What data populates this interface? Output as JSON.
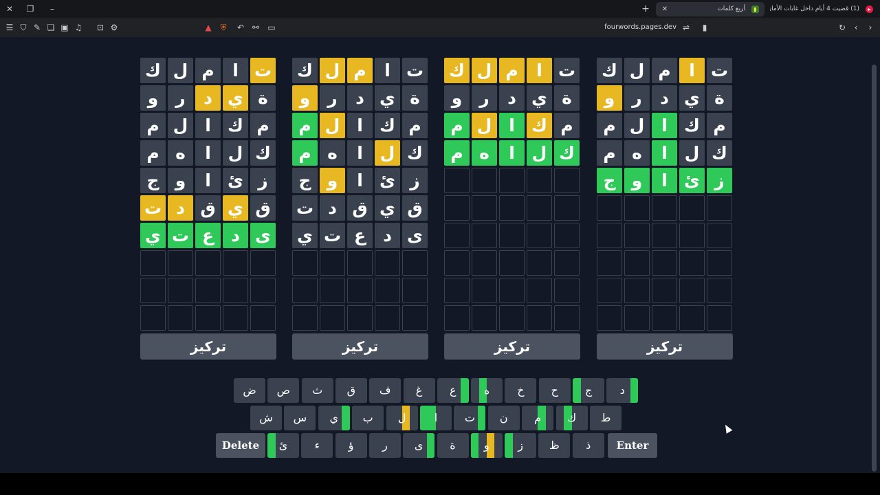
{
  "browser": {
    "active_tab": "أربع كلمات",
    "inactive_tab": "(1) قضيت 4 أيام داخل غابات الأمازون !",
    "url": "fourwords.pages.dev"
  },
  "colors": {
    "correct": "#2fc95a",
    "present": "#e8b823",
    "absent": "#3a4250",
    "background": "#121826"
  },
  "boards": [
    {
      "rows": [
        [
          "ت",
          "ا",
          "م",
          "ل",
          "ك"
        ],
        [
          "ة",
          "ي",
          "د",
          "ر",
          "و"
        ],
        [
          "م",
          "ك",
          "ا",
          "ل",
          "م"
        ],
        [
          "ك",
          "ل",
          "ا",
          "ه",
          "م"
        ],
        [
          "ز",
          "ئ",
          "ا",
          "و",
          "ج"
        ],
        [
          "ق",
          "ي",
          "ق",
          "د",
          "ت"
        ],
        [
          "ى",
          "د",
          "ع",
          "ت",
          "ي"
        ]
      ],
      "states": [
        [
          "y",
          "g0",
          "g0",
          "g0",
          "g0"
        ],
        [
          "g0",
          "y",
          "y",
          "g0",
          "g0"
        ],
        [
          "g0",
          "g0",
          "g0",
          "g0",
          "g0"
        ],
        [
          "g0",
          "g0",
          "g0",
          "g0",
          "g0"
        ],
        [
          "g0",
          "g0",
          "g0",
          "g0",
          "g0"
        ],
        [
          "g0",
          "y",
          "g0",
          "y",
          "y"
        ],
        [
          "G",
          "G",
          "G",
          "G",
          "G"
        ]
      ],
      "focus_label": "تركيز"
    },
    {
      "rows": [
        [
          "ت",
          "ا",
          "م",
          "ل",
          "ك"
        ],
        [
          "ة",
          "ي",
          "د",
          "ر",
          "و"
        ],
        [
          "م",
          "ك",
          "ا",
          "ل",
          "م"
        ],
        [
          "ك",
          "ل",
          "ا",
          "ه",
          "م"
        ],
        [
          "ز",
          "ئ",
          "ا",
          "و",
          "ج"
        ],
        [
          "ق",
          "ي",
          "ق",
          "د",
          "ت"
        ],
        [
          "ى",
          "د",
          "ع",
          "ت",
          "ي"
        ]
      ],
      "states": [
        [
          "g0",
          "g0",
          "y",
          "y",
          "g0"
        ],
        [
          "g0",
          "g0",
          "g0",
          "g0",
          "y"
        ],
        [
          "g0",
          "g0",
          "g0",
          "y",
          "G"
        ],
        [
          "g0",
          "y",
          "g0",
          "g0",
          "G"
        ],
        [
          "g0",
          "g0",
          "g0",
          "y",
          "g0"
        ],
        [
          "g0",
          "g0",
          "g0",
          "g0",
          "g0"
        ],
        [
          "g0",
          "g0",
          "g0",
          "g0",
          "g0"
        ]
      ],
      "focus_label": "تركيز"
    },
    {
      "rows": [
        [
          "ت",
          "ا",
          "م",
          "ل",
          "ك"
        ],
        [
          "ة",
          "ي",
          "د",
          "ر",
          "و"
        ],
        [
          "م",
          "ك",
          "ا",
          "ل",
          "م"
        ],
        [
          "ك",
          "ل",
          "ا",
          "ه",
          "م"
        ]
      ],
      "states": [
        [
          "g0",
          "y",
          "y",
          "y",
          "y"
        ],
        [
          "g0",
          "g0",
          "g0",
          "g0",
          "g0"
        ],
        [
          "g0",
          "y",
          "G",
          "y",
          "G"
        ],
        [
          "G",
          "G",
          "G",
          "G",
          "G"
        ]
      ],
      "focus_label": "تركيز"
    },
    {
      "rows": [
        [
          "ت",
          "ا",
          "م",
          "ل",
          "ك"
        ],
        [
          "ة",
          "ي",
          "د",
          "ر",
          "و"
        ],
        [
          "م",
          "ك",
          "ا",
          "ل",
          "م"
        ],
        [
          "ك",
          "ل",
          "ا",
          "ه",
          "م"
        ],
        [
          "ز",
          "ئ",
          "ا",
          "و",
          "ج"
        ]
      ],
      "states": [
        [
          "g0",
          "y",
          "g0",
          "g0",
          "g0"
        ],
        [
          "g0",
          "g0",
          "g0",
          "g0",
          "y"
        ],
        [
          "g0",
          "g0",
          "G",
          "g0",
          "g0"
        ],
        [
          "g0",
          "g0",
          "G",
          "g0",
          "g0"
        ],
        [
          "G",
          "G",
          "G",
          "G",
          "G"
        ]
      ],
      "focus_label": "تركيز"
    }
  ],
  "keyboard": {
    "row1": [
      {
        "k": "ض",
        "s": [
          "d",
          "d",
          "d",
          "d"
        ]
      },
      {
        "k": "ص",
        "s": [
          "d",
          "d",
          "d",
          "d"
        ]
      },
      {
        "k": "ث",
        "s": [
          "d",
          "d",
          "d",
          "d"
        ]
      },
      {
        "k": "ق",
        "s": [
          "d",
          "d",
          "d",
          "d"
        ]
      },
      {
        "k": "ف",
        "s": [
          "d",
          "d",
          "d",
          "d"
        ]
      },
      {
        "k": "غ",
        "s": [
          "d",
          "d",
          "d",
          "d"
        ]
      },
      {
        "k": "ع",
        "s": [
          "g",
          "d",
          "d",
          "d"
        ]
      },
      {
        "k": "ه",
        "s": [
          "d",
          "d",
          "g",
          "d"
        ]
      },
      {
        "k": "خ",
        "s": [
          "d",
          "d",
          "d",
          "d"
        ]
      },
      {
        "k": "ح",
        "s": [
          "d",
          "d",
          "d",
          "d"
        ]
      },
      {
        "k": "ج",
        "s": [
          "d",
          "d",
          "d",
          "g"
        ]
      },
      {
        "k": "د",
        "s": [
          "g",
          "d",
          "d",
          "d"
        ]
      }
    ],
    "row2": [
      {
        "k": "ش",
        "s": [
          "d",
          "d",
          "d",
          "d"
        ]
      },
      {
        "k": "س",
        "s": [
          "d",
          "d",
          "d",
          "d"
        ]
      },
      {
        "k": "ي",
        "s": [
          "g",
          "d",
          "d",
          "d"
        ]
      },
      {
        "k": "ب",
        "s": [
          "d",
          "d",
          "d",
          "d"
        ]
      },
      {
        "k": "ل",
        "s": [
          "d",
          "y",
          "d",
          "d"
        ]
      },
      {
        "k": "ا",
        "s": [
          "d",
          "d",
          "g",
          "g"
        ]
      },
      {
        "k": "ت",
        "s": [
          "g",
          "d",
          "d",
          "d"
        ]
      },
      {
        "k": "ن",
        "s": [
          "d",
          "d",
          "d",
          "d"
        ]
      },
      {
        "k": "م",
        "s": [
          "d",
          "g",
          "d",
          "d"
        ]
      },
      {
        "k": "ك",
        "s": [
          "d",
          "d",
          "g",
          "d"
        ]
      },
      {
        "k": "ط",
        "s": [
          "d",
          "d",
          "d",
          "d"
        ]
      }
    ],
    "row3_keys": [
      {
        "k": "ئ",
        "s": [
          "d",
          "d",
          "d",
          "g"
        ]
      },
      {
        "k": "ء",
        "s": [
          "d",
          "d",
          "d",
          "d"
        ]
      },
      {
        "k": "ؤ",
        "s": [
          "d",
          "d",
          "d",
          "d"
        ]
      },
      {
        "k": "ر",
        "s": [
          "d",
          "d",
          "d",
          "d"
        ]
      },
      {
        "k": "ى",
        "s": [
          "g",
          "d",
          "d",
          "d"
        ]
      },
      {
        "k": "ة",
        "s": [
          "d",
          "d",
          "d",
          "d"
        ]
      },
      {
        "k": "و",
        "s": [
          "d",
          "y",
          "d",
          "g"
        ]
      },
      {
        "k": "ز",
        "s": [
          "d",
          "d",
          "d",
          "g"
        ]
      },
      {
        "k": "ظ",
        "s": [
          "d",
          "d",
          "d",
          "d"
        ]
      },
      {
        "k": "ذ",
        "s": [
          "d",
          "d",
          "d",
          "d"
        ]
      }
    ],
    "delete_label": "Delete",
    "enter_label": "Enter"
  }
}
